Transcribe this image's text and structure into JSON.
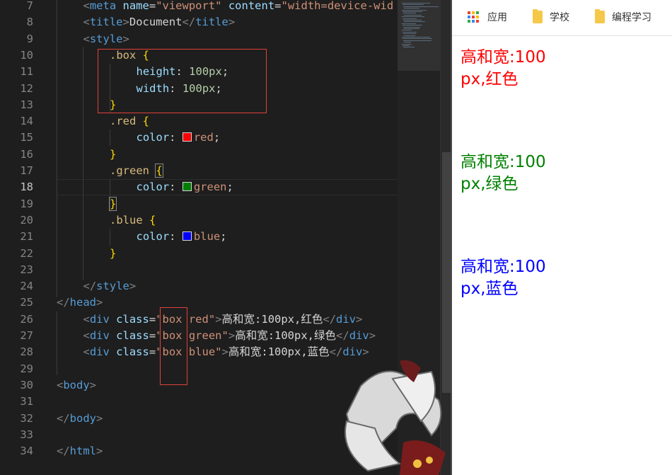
{
  "editor": {
    "active_line": 18,
    "lines": [
      {
        "n": "7",
        "indent": 1,
        "tokens": [
          [
            "t-punc",
            "<"
          ],
          [
            "t-tag",
            "meta "
          ],
          [
            "t-attr",
            "name"
          ],
          [
            "t-txt",
            "="
          ],
          [
            "t-str",
            "\"viewport\" "
          ],
          [
            "t-attr",
            "content"
          ],
          [
            "t-txt",
            "="
          ],
          [
            "t-str",
            "\"width=device-wid"
          ]
        ]
      },
      {
        "n": "8",
        "indent": 1,
        "tokens": [
          [
            "t-punc",
            "<"
          ],
          [
            "t-tag",
            "title"
          ],
          [
            "t-punc",
            ">"
          ],
          [
            "t-txt",
            "Document"
          ],
          [
            "t-punc",
            "</"
          ],
          [
            "t-tag",
            "title"
          ],
          [
            "t-punc",
            ">"
          ]
        ]
      },
      {
        "n": "9",
        "indent": 1,
        "tokens": [
          [
            "t-punc",
            "<"
          ],
          [
            "t-tag",
            "style"
          ],
          [
            "t-punc",
            ">"
          ]
        ]
      },
      {
        "n": "10",
        "indent": 2,
        "tokens": [
          [
            "t-sel",
            ".box "
          ],
          [
            "t-br",
            "{"
          ]
        ]
      },
      {
        "n": "11",
        "indent": 3,
        "tokens": [
          [
            "t-prop",
            "height"
          ],
          [
            "t-txt",
            ": "
          ],
          [
            "t-num",
            "100px"
          ],
          [
            "t-txt",
            ";"
          ]
        ]
      },
      {
        "n": "12",
        "indent": 3,
        "tokens": [
          [
            "t-prop",
            "width"
          ],
          [
            "t-txt",
            ": "
          ],
          [
            "t-num",
            "100px"
          ],
          [
            "t-txt",
            ";"
          ]
        ]
      },
      {
        "n": "13",
        "indent": 2,
        "tokens": [
          [
            "t-br",
            "}"
          ]
        ]
      },
      {
        "n": "14",
        "indent": 2,
        "tokens": [
          [
            "t-sel",
            ".red "
          ],
          [
            "t-br",
            "{"
          ]
        ]
      },
      {
        "n": "15",
        "indent": 3,
        "tokens": [
          [
            "t-prop",
            "color"
          ],
          [
            "t-txt",
            ": "
          ],
          [
            "swatch",
            "#ff0000"
          ],
          [
            "t-str",
            "red"
          ],
          [
            "t-txt",
            ";"
          ]
        ]
      },
      {
        "n": "16",
        "indent": 2,
        "tokens": [
          [
            "t-br",
            "}"
          ]
        ]
      },
      {
        "n": "17",
        "indent": 2,
        "tokens": [
          [
            "t-sel",
            ".green "
          ],
          [
            "t-br-box",
            "{"
          ]
        ]
      },
      {
        "n": "18",
        "indent": 3,
        "tokens": [
          [
            "t-prop",
            "color"
          ],
          [
            "t-txt",
            ": "
          ],
          [
            "swatch",
            "#008000"
          ],
          [
            "t-str",
            "green"
          ],
          [
            "t-txt",
            ";"
          ]
        ]
      },
      {
        "n": "19",
        "indent": 2,
        "tokens": [
          [
            "t-br-box",
            "}"
          ]
        ]
      },
      {
        "n": "20",
        "indent": 2,
        "tokens": [
          [
            "t-sel",
            ".blue "
          ],
          [
            "t-br",
            "{"
          ]
        ]
      },
      {
        "n": "21",
        "indent": 3,
        "tokens": [
          [
            "t-prop",
            "color"
          ],
          [
            "t-txt",
            ": "
          ],
          [
            "swatch",
            "#0000ff"
          ],
          [
            "t-str",
            "blue"
          ],
          [
            "t-txt",
            ";"
          ]
        ]
      },
      {
        "n": "22",
        "indent": 2,
        "tokens": [
          [
            "t-br",
            "}"
          ]
        ]
      },
      {
        "n": "23",
        "indent": 0,
        "tokens": []
      },
      {
        "n": "24",
        "indent": 1,
        "tokens": [
          [
            "t-punc",
            "</"
          ],
          [
            "t-tag",
            "style"
          ],
          [
            "t-punc",
            ">"
          ]
        ]
      },
      {
        "n": "25",
        "indent": 0,
        "tokens": [
          [
            "t-punc",
            "</"
          ],
          [
            "t-tag",
            "head"
          ],
          [
            "t-punc",
            ">"
          ]
        ]
      },
      {
        "n": "26",
        "indent": 1,
        "tokens": [
          [
            "t-punc",
            "<"
          ],
          [
            "t-tag",
            "div "
          ],
          [
            "t-attr",
            "class"
          ],
          [
            "t-txt",
            "="
          ],
          [
            "t-str",
            "\"box red\""
          ],
          [
            "t-punc",
            ">"
          ],
          [
            "t-txt",
            "高和宽:100px,红色"
          ],
          [
            "t-punc",
            "</"
          ],
          [
            "t-tag",
            "div"
          ],
          [
            "t-punc",
            ">"
          ]
        ]
      },
      {
        "n": "27",
        "indent": 1,
        "tokens": [
          [
            "t-punc",
            "<"
          ],
          [
            "t-tag",
            "div "
          ],
          [
            "t-attr",
            "class"
          ],
          [
            "t-txt",
            "="
          ],
          [
            "t-str",
            "\"box green\""
          ],
          [
            "t-punc",
            ">"
          ],
          [
            "t-txt",
            "高和宽:100px,绿色"
          ],
          [
            "t-punc",
            "</"
          ],
          [
            "t-tag",
            "div"
          ],
          [
            "t-punc",
            ">"
          ]
        ]
      },
      {
        "n": "28",
        "indent": 1,
        "tokens": [
          [
            "t-punc",
            "<"
          ],
          [
            "t-tag",
            "div "
          ],
          [
            "t-attr",
            "class"
          ],
          [
            "t-txt",
            "="
          ],
          [
            "t-str",
            "\"box blue\""
          ],
          [
            "t-punc",
            ">"
          ],
          [
            "t-txt",
            "高和宽:100px,蓝色"
          ],
          [
            "t-punc",
            "</"
          ],
          [
            "t-tag",
            "div"
          ],
          [
            "t-punc",
            ">"
          ]
        ]
      },
      {
        "n": "29",
        "indent": 0,
        "tokens": []
      },
      {
        "n": "30",
        "indent": 0,
        "tokens": [
          [
            "t-punc",
            "<"
          ],
          [
            "t-tag",
            "body"
          ],
          [
            "t-punc",
            ">"
          ]
        ]
      },
      {
        "n": "31",
        "indent": 0,
        "tokens": []
      },
      {
        "n": "32",
        "indent": 0,
        "tokens": [
          [
            "t-punc",
            "</"
          ],
          [
            "t-tag",
            "body"
          ],
          [
            "t-punc",
            ">"
          ]
        ]
      },
      {
        "n": "33",
        "indent": 0,
        "tokens": []
      },
      {
        "n": "34",
        "indent": 0,
        "tokens": [
          [
            "t-punc",
            "</"
          ],
          [
            "t-tag",
            "html"
          ],
          [
            "t-punc",
            ">"
          ]
        ]
      }
    ]
  },
  "bookmarks": {
    "apps_label": "应用",
    "folders": [
      "学校",
      "编程学习"
    ],
    "apps_icon": "apps-grid-icon",
    "folder_icon": "folder-icon"
  },
  "preview": {
    "boxes": [
      {
        "text": "高和宽:100px,红色",
        "color": "#ff0000"
      },
      {
        "text": "高和宽:100px,绿色",
        "color": "#008000"
      },
      {
        "text": "高和宽:100px,蓝色",
        "color": "#0000ff"
      }
    ]
  },
  "colors": {
    "highlight_box": "#e0413c"
  }
}
